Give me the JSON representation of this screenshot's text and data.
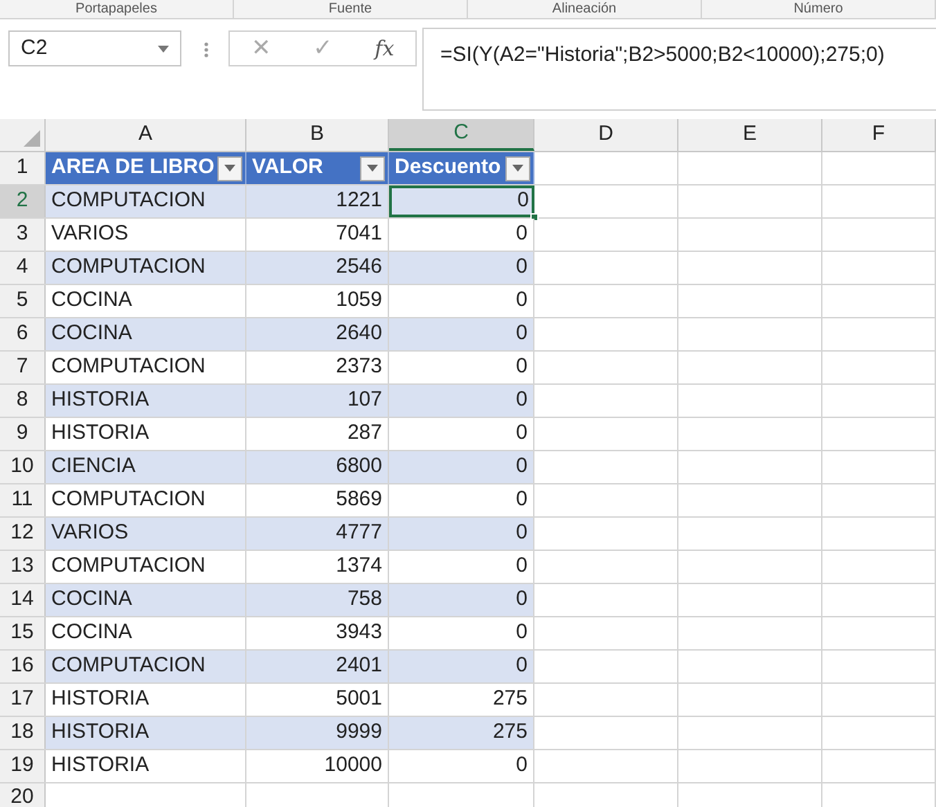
{
  "ribbon_groups": [
    "Portapapeles",
    "Fuente",
    "Alineación",
    "Número"
  ],
  "name_box": "C2",
  "formula_bar": {
    "cancel": "✕",
    "enter": "✓",
    "function": "fx",
    "formula": "=SI(Y(A2=\"Historia\";B2>5000;B2<10000);275;0)"
  },
  "columns": [
    {
      "label": "A",
      "selected": false
    },
    {
      "label": "B",
      "selected": false
    },
    {
      "label": "C",
      "selected": true
    },
    {
      "label": "D",
      "selected": false
    },
    {
      "label": "E",
      "selected": false
    },
    {
      "label": "F",
      "selected": false
    }
  ],
  "table_headers": [
    "AREA DE LIBRO",
    "VALOR",
    "Descuento"
  ],
  "header_row": "1",
  "rows": [
    {
      "number": "2",
      "selected": true,
      "cells": [
        "COMPUTACION",
        "1221",
        "0"
      ]
    },
    {
      "number": "3",
      "selected": false,
      "cells": [
        "VARIOS",
        "7041",
        "0"
      ]
    },
    {
      "number": "4",
      "selected": false,
      "cells": [
        "COMPUTACION",
        "2546",
        "0"
      ]
    },
    {
      "number": "5",
      "selected": false,
      "cells": [
        "COCINA",
        "1059",
        "0"
      ]
    },
    {
      "number": "6",
      "selected": false,
      "cells": [
        "COCINA",
        "2640",
        "0"
      ]
    },
    {
      "number": "7",
      "selected": false,
      "cells": [
        "COMPUTACION",
        "2373",
        "0"
      ]
    },
    {
      "number": "8",
      "selected": false,
      "cells": [
        "HISTORIA",
        "107",
        "0"
      ]
    },
    {
      "number": "9",
      "selected": false,
      "cells": [
        "HISTORIA",
        "287",
        "0"
      ]
    },
    {
      "number": "10",
      "selected": false,
      "cells": [
        "CIENCIA",
        "6800",
        "0"
      ]
    },
    {
      "number": "11",
      "selected": false,
      "cells": [
        "COMPUTACION",
        "5869",
        "0"
      ]
    },
    {
      "number": "12",
      "selected": false,
      "cells": [
        "VARIOS",
        "4777",
        "0"
      ]
    },
    {
      "number": "13",
      "selected": false,
      "cells": [
        "COMPUTACION",
        "1374",
        "0"
      ]
    },
    {
      "number": "14",
      "selected": false,
      "cells": [
        "COCINA",
        "758",
        "0"
      ]
    },
    {
      "number": "15",
      "selected": false,
      "cells": [
        "COCINA",
        "3943",
        "0"
      ]
    },
    {
      "number": "16",
      "selected": false,
      "cells": [
        "COMPUTACION",
        "2401",
        "0"
      ]
    },
    {
      "number": "17",
      "selected": false,
      "cells": [
        "HISTORIA",
        "5001",
        "275"
      ]
    },
    {
      "number": "18",
      "selected": false,
      "cells": [
        "HISTORIA",
        "9999",
        "275"
      ]
    },
    {
      "number": "19",
      "selected": false,
      "cells": [
        "HISTORIA",
        "10000",
        "0"
      ]
    }
  ],
  "empty_rows": [
    "20"
  ]
}
